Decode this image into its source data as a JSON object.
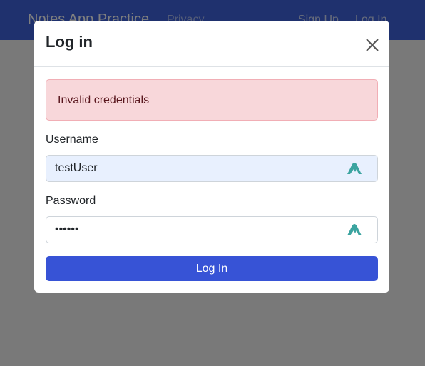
{
  "navbar": {
    "brand": "Notes App Practice",
    "links": [
      "Privacy",
      "Sign Up",
      "Log In"
    ]
  },
  "modal": {
    "title": "Log in",
    "alert_text": "Invalid credentials",
    "username": {
      "label": "Username",
      "value": "testUser"
    },
    "password": {
      "label": "Password",
      "value": "••••••"
    },
    "submit_label": "Log In"
  },
  "colors": {
    "navbar": "#3f63dc",
    "alert_bg": "#f8d7da",
    "primary_button": "#3753d6",
    "password_manager_icon": "#3ba4a0"
  },
  "icons": {
    "close": "close-icon",
    "password_manager": "password-manager-icon"
  }
}
